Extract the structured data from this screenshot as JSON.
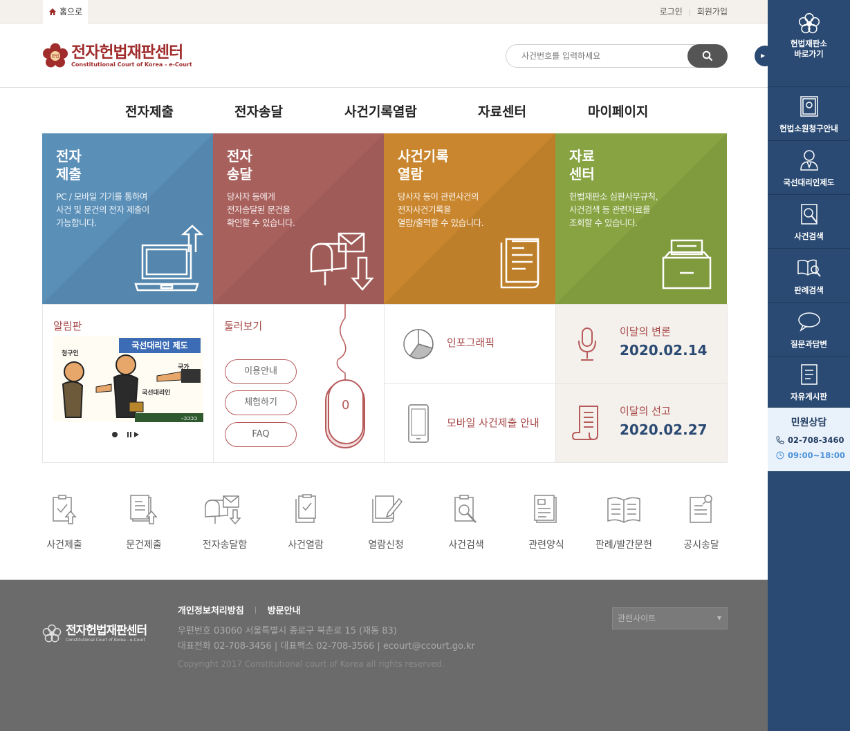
{
  "topbar": {
    "home_label": "홈으로",
    "login": "로그인",
    "signup": "회원가입"
  },
  "logo": {
    "title": "전자헌법재판센터",
    "subtitle": "Constitutional Court of Korea - e-Court",
    "seal": "헌법"
  },
  "search": {
    "placeholder": "사건번호를 입력하세요"
  },
  "nav": [
    "전자제출",
    "전자송달",
    "사건기록열람",
    "자료센터",
    "마이페이지"
  ],
  "tiles": [
    {
      "title1": "전자",
      "title2": "제출",
      "desc1": "PC / 모바일 기기를 통하여",
      "desc2": "사건 및 문건의 전자 제출이",
      "desc3": "가능합니다.",
      "color": "#5a8fb8"
    },
    {
      "title1": "전자",
      "title2": "송달",
      "desc1": "당사자 등에게",
      "desc2": "전자송달된 문건을",
      "desc3": "확인할 수 있습니다.",
      "color": "#a8605c"
    },
    {
      "title1": "사건기록",
      "title2": "열람",
      "desc1": "당사자 등이 관련사건의",
      "desc2": "전자사건기록을",
      "desc3": "열람/출력할 수 있습니다.",
      "color": "#c9862e"
    },
    {
      "title1": "자료",
      "title2": "센터",
      "desc1": "헌법재판소 심판사무규칙,",
      "desc2": "사건검색 등 관련자료를",
      "desc3": "조회할 수 있습니다.",
      "color": "#87a342"
    }
  ],
  "notice": {
    "title": "알림판",
    "banner_title": "국선대리인 제도",
    "cartoon_labels": [
      "청구인",
      "국가",
      "국선대리인"
    ]
  },
  "browse": {
    "title": "둘러보기",
    "buttons": [
      "이용안내",
      "체험하기",
      "FAQ"
    ],
    "mouse_digit": "0"
  },
  "info": {
    "infographic": "인포그래픽",
    "mobile": "모바일 사건제출 안내"
  },
  "monthly": {
    "argue_label": "이달의 변론",
    "argue_date": "2020.02.14",
    "verdict_label": "이달의 선고",
    "verdict_date": "2020.02.27"
  },
  "quick": [
    "사건제출",
    "문건제출",
    "전자송달함",
    "사건열람",
    "열람신청",
    "사건검색",
    "관련양식",
    "판례/발간문헌",
    "공시송달"
  ],
  "footer": {
    "privacy": "개인정보처리방침",
    "visit": "방문안내",
    "address": "우편번호 03060 서울특별시 종로구 북촌로 15 (재동 83)",
    "contact": "대표전화 02-708-3456 | 대표팩스 02-708-3566 | ecourt@ccourt.go.kr",
    "copyright": "Copyright 2017 Constitutional court of Korea all rights reserved.",
    "related": "관련사이트",
    "logo_title": "전자헌법재판센터",
    "logo_sub": "Constitutional Court of Korea - e-Court"
  },
  "sidebar": {
    "shortcut1": "헌법재판소",
    "shortcut2": "바로가기",
    "items": [
      "헌법소원청구안내",
      "국선대리인제도",
      "사건검색",
      "판례검색",
      "질문과답변",
      "자유게시판"
    ],
    "cs_title": "민원상담",
    "cs_phone": "02-708-3460",
    "cs_hours": "09:00~18:00"
  }
}
